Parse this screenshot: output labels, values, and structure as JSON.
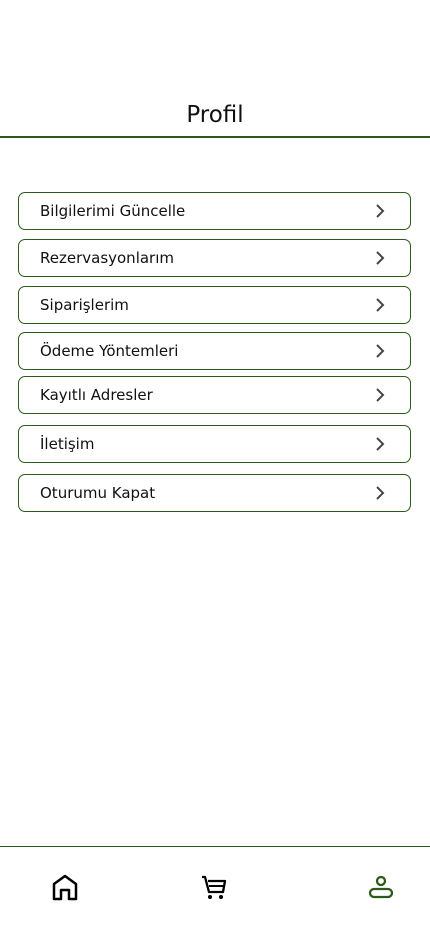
{
  "header": {
    "title": "Profil"
  },
  "menu": [
    {
      "label": "Bilgilerimi Güncelle"
    },
    {
      "label": "Rezervasyonlarım"
    },
    {
      "label": "Siparişlerim"
    },
    {
      "label": "Ödeme Yöntemleri"
    },
    {
      "label": "Kayıtlı Adresler"
    },
    {
      "label": "İletişim"
    },
    {
      "label": "Oturumu Kapat"
    }
  ],
  "bottom_nav": {
    "items": [
      "home-icon",
      "cart-icon",
      "profile-icon"
    ],
    "active": "profile-icon"
  },
  "colors": {
    "accent": "#2d5a1b"
  }
}
